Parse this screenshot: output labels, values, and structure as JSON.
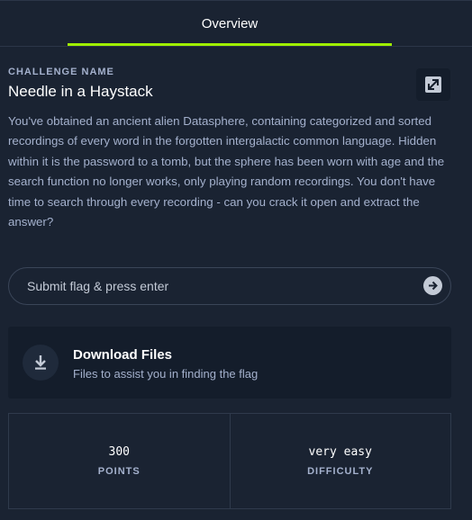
{
  "tabs": {
    "active_label": "Overview"
  },
  "challenge": {
    "section_label": "CHALLENGE NAME",
    "title": "Needle in a Haystack",
    "description": "You've obtained an ancient alien Datasphere, containing categorized and sorted recordings of every word in the forgotten intergalactic common language. Hidden within it is the password to a tomb, but the sphere has been worn with age and the search function no longer works, only playing random recordings. You don't have time to search through every recording - can you crack it open and extract the answer?"
  },
  "flag": {
    "placeholder": "Submit flag & press enter",
    "value": ""
  },
  "download": {
    "title": "Download Files",
    "subtitle": "Files to assist you in finding the flag"
  },
  "stats": {
    "points_value": "300",
    "points_label": "POINTS",
    "difficulty_value": "very easy",
    "difficulty_label": "DIFFICULTY"
  },
  "colors": {
    "background": "#1a2332",
    "card": "#141d2b",
    "accent": "#9fef00",
    "muted_text": "#a4b1cd"
  },
  "icons": {
    "share": "share-icon",
    "submit": "arrow-right-circle-icon",
    "download": "download-icon"
  }
}
